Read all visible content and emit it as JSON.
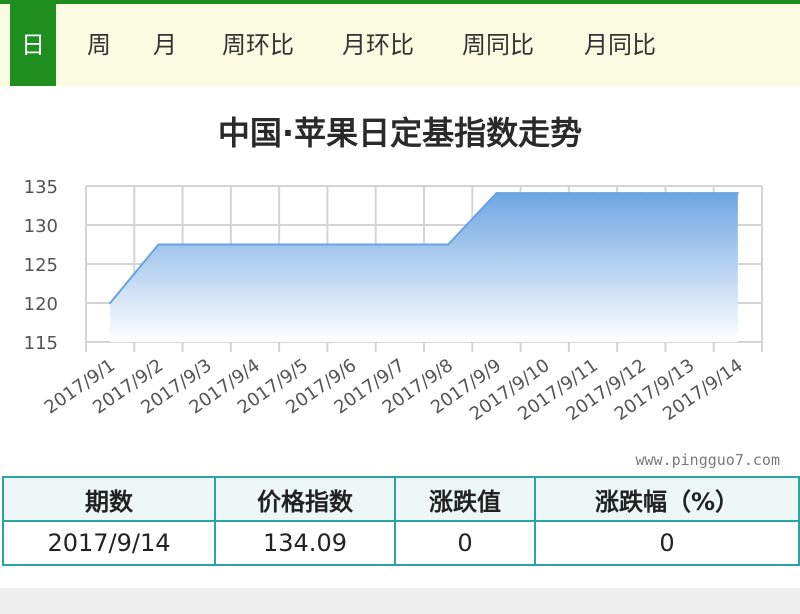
{
  "tabs": [
    {
      "label": "日",
      "active": true
    },
    {
      "label": "周",
      "active": false
    },
    {
      "label": "月",
      "active": false
    },
    {
      "label": "周环比",
      "active": false
    },
    {
      "label": "月环比",
      "active": false
    },
    {
      "label": "周同比",
      "active": false
    },
    {
      "label": "月同比",
      "active": false
    }
  ],
  "chart_data": {
    "type": "area",
    "title": "中国·苹果日定基指数走势",
    "categories": [
      "2017/9/1",
      "2017/9/2",
      "2017/9/3",
      "2017/9/4",
      "2017/9/5",
      "2017/9/6",
      "2017/9/7",
      "2017/9/8",
      "2017/9/9",
      "2017/9/10",
      "2017/9/11",
      "2017/9/12",
      "2017/9/13",
      "2017/9/14"
    ],
    "series": [
      {
        "values": [
          120.0,
          127.5,
          127.5,
          127.5,
          127.5,
          127.5,
          127.5,
          127.5,
          134.09,
          134.09,
          134.09,
          134.09,
          134.09,
          134.09
        ]
      }
    ],
    "ylim": [
      115,
      135
    ],
    "yticks": [
      115,
      120,
      125,
      130,
      135
    ],
    "grid": true,
    "xlabel": "",
    "ylabel": "",
    "line_color": "#6aa3df",
    "fill_color_top": "#6ea6e2",
    "fill_color_bottom": "#ffffff"
  },
  "watermark": "www.pingguo7.com",
  "table": {
    "headers": [
      "期数",
      "价格指数",
      "涨跌值",
      "涨跌幅（%）"
    ],
    "rows": [
      [
        "2017/9/14",
        "134.09",
        "0",
        "0"
      ]
    ]
  },
  "colors": {
    "accent": "#1e8f1e",
    "tab_bar_bg": "#fbfbe2",
    "table_border": "#2aa6a0"
  }
}
